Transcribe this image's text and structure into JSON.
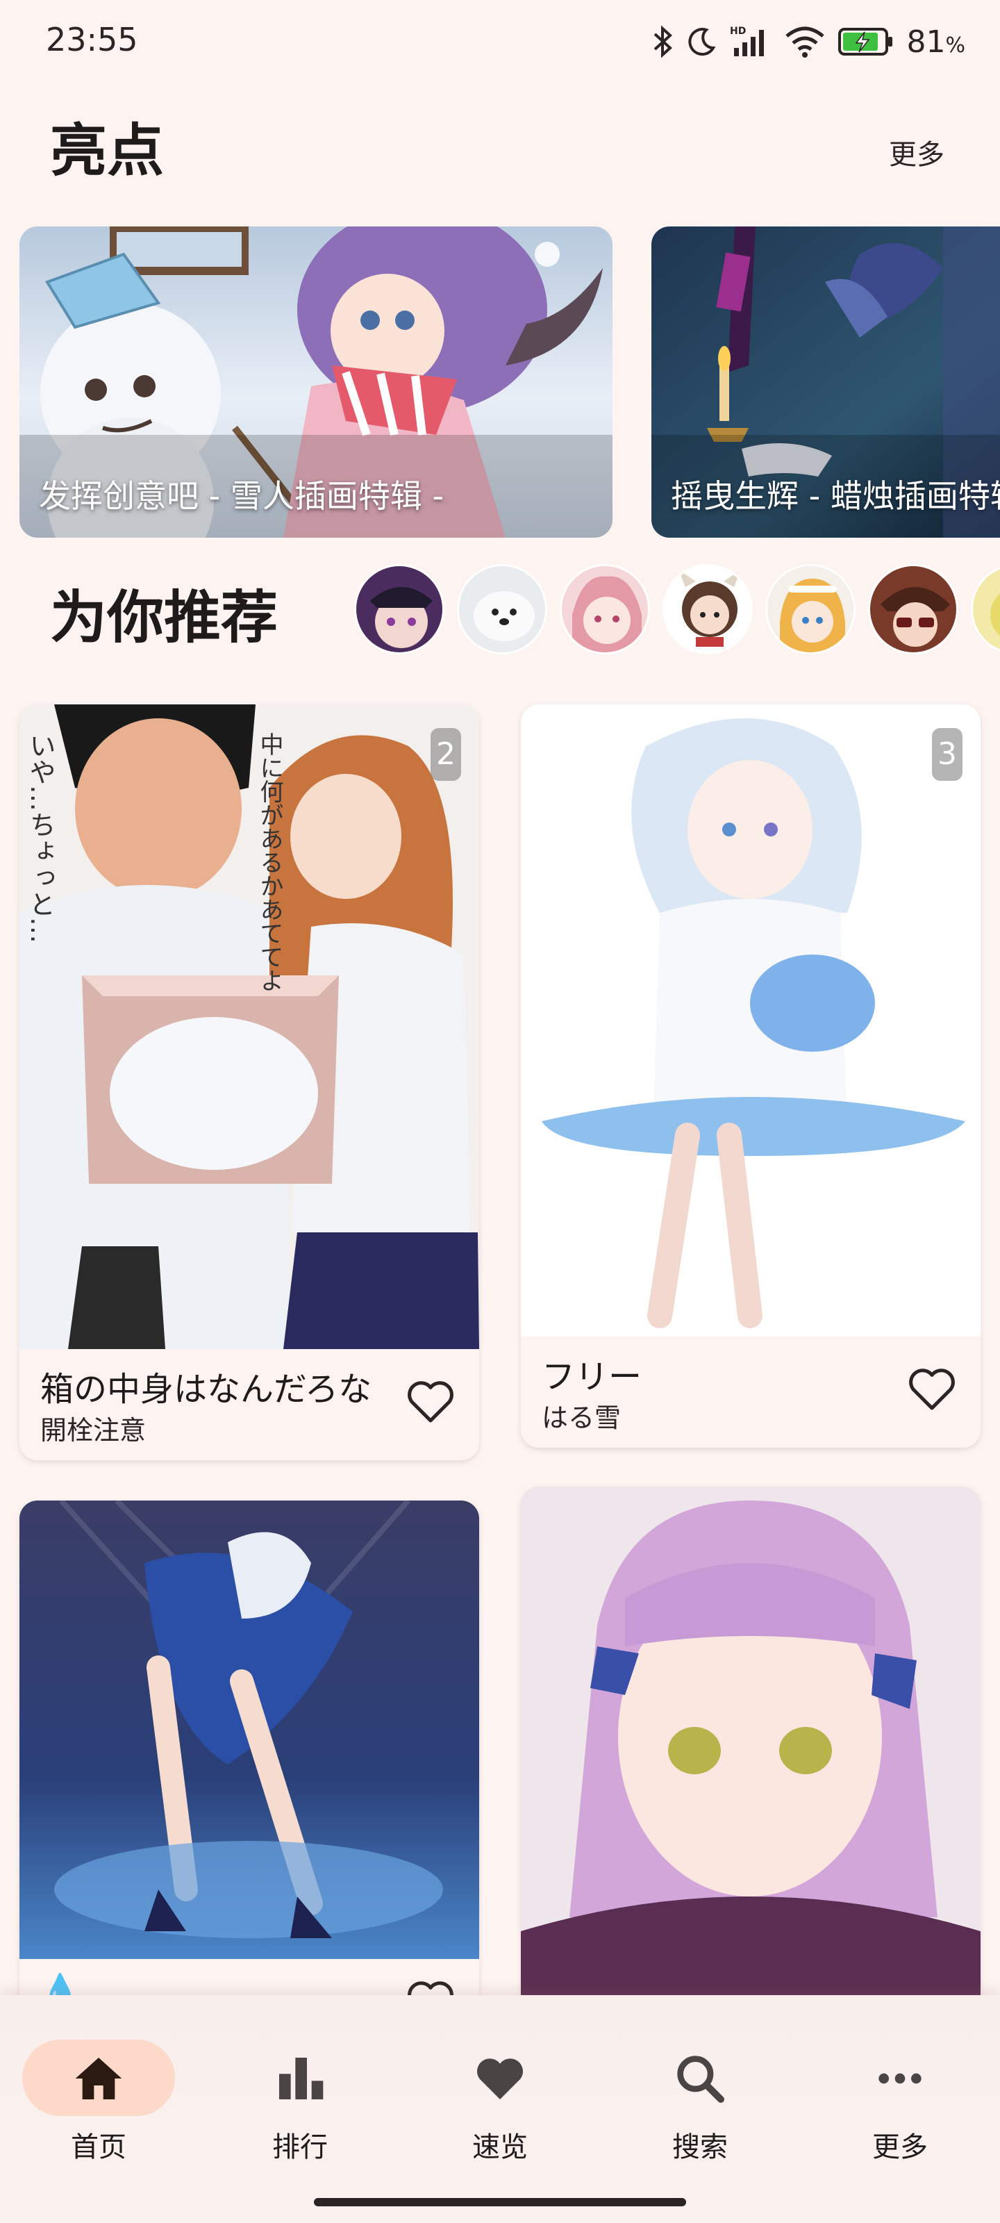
{
  "status_bar": {
    "time": "23:55",
    "battery_percent": "81",
    "battery_unit": "%",
    "icons": [
      "bluetooth-icon",
      "moon-icon",
      "hd-signal-icon",
      "wifi-icon",
      "battery-charging-icon"
    ]
  },
  "highlights": {
    "title": "亮点",
    "more_label": "更多",
    "cards": [
      {
        "caption": "发挥创意吧 - 雪人插画特辑 -"
      },
      {
        "caption": "摇曳生辉 - 蜡烛插画特辑 -"
      }
    ]
  },
  "recommend": {
    "title": "为你推荐",
    "avatars": [
      "avatar-1",
      "avatar-2",
      "avatar-3",
      "avatar-4",
      "avatar-5",
      "avatar-6",
      "avatar-7"
    ]
  },
  "feed": [
    {
      "title": "箱の中身はなんだろな",
      "author": "開栓注意",
      "page_count": "2",
      "favorited": false
    },
    {
      "title": "フリー",
      "author": "はる雪",
      "page_count": "3",
      "favorited": false
    },
    {
      "title": "",
      "author": "💧",
      "favorited": false
    },
    {
      "title": "",
      "author": "",
      "favorited": false
    }
  ],
  "artwork_text": {
    "left_vertical_1": "いや…ちょっと…",
    "left_vertical_2": "中に何があるかあててよ"
  },
  "bottom_nav": {
    "active": "首页",
    "items": [
      {
        "label": "首页",
        "icon": "home-icon"
      },
      {
        "label": "排行",
        "icon": "bar-chart-icon"
      },
      {
        "label": "速览",
        "icon": "heart-icon"
      },
      {
        "label": "搜索",
        "icon": "search-icon"
      },
      {
        "label": "更多",
        "icon": "more-horizontal-icon"
      }
    ]
  },
  "colors": {
    "background": "#fdf4f2",
    "nav_active_pill": "#fcd9c9",
    "text_primary": "#1f1b1a",
    "battery_green": "#3fbf3f"
  }
}
